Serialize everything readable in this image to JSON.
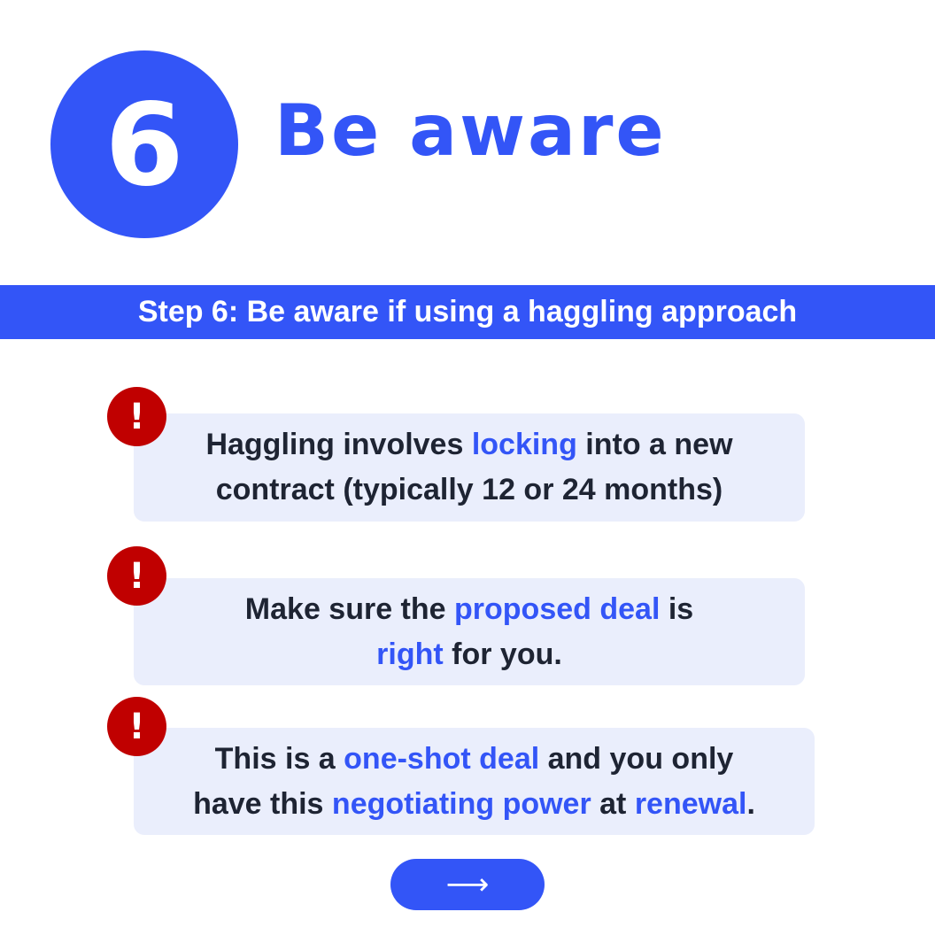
{
  "step": {
    "number": "6",
    "title": "Be aware"
  },
  "banner": {
    "text": "Step 6: Be aware if using a haggling approach"
  },
  "alert_icon": {
    "name": "exclamation-icon",
    "glyph": "!"
  },
  "cards": [
    {
      "line1": [
        {
          "text": "Haggling involves ",
          "highlight": false
        },
        {
          "text": "locking",
          "highlight": true
        },
        {
          "text": " into a new",
          "highlight": false
        }
      ],
      "line2": [
        {
          "text": "contract (typically 12 or 24 months)",
          "highlight": false
        }
      ]
    },
    {
      "line1": [
        {
          "text": "Make sure the ",
          "highlight": false
        },
        {
          "text": "proposed deal",
          "highlight": true
        },
        {
          "text": " is",
          "highlight": false
        }
      ],
      "line2": [
        {
          "text": "right",
          "highlight": true
        },
        {
          "text": " for you.",
          "highlight": false
        }
      ]
    },
    {
      "line1": [
        {
          "text": "This is a ",
          "highlight": false
        },
        {
          "text": "one-shot deal",
          "highlight": true
        },
        {
          "text": " and you only",
          "highlight": false
        }
      ],
      "line2": [
        {
          "text": "have this ",
          "highlight": false
        },
        {
          "text": "negotiating power",
          "highlight": true
        },
        {
          "text": " at ",
          "highlight": false
        },
        {
          "text": "renewal",
          "highlight": true
        },
        {
          "text": ".",
          "highlight": false
        }
      ]
    }
  ],
  "next_button": {
    "icon": "arrow-right-icon",
    "glyph": "⟶"
  },
  "colors": {
    "accent": "#3355f7",
    "card_bg": "#eaeefc",
    "alert": "#c00000",
    "text": "#1e2433"
  }
}
